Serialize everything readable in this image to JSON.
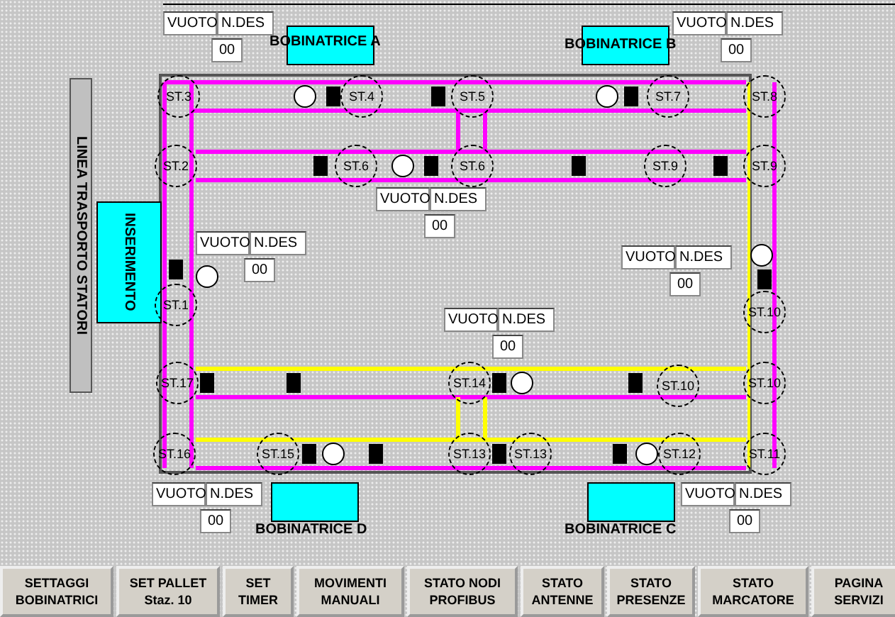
{
  "line_label": "LINEA TRASPORTO STATORI",
  "insertion_label": "INSERIMENTO",
  "winders": [
    {
      "label": "BOBINATRICE A"
    },
    {
      "label": "BOBINATRICE B"
    },
    {
      "label": "BOBINATRICE D"
    },
    {
      "label": "BOBINATRICE C"
    }
  ],
  "counters": [
    {
      "empty": "VUOTO",
      "count_label": "N.DES",
      "value": "00"
    },
    {
      "empty": "VUOTO",
      "count_label": "N.DES",
      "value": "00"
    },
    {
      "empty": "VUOTO",
      "count_label": "N.DES",
      "value": "00"
    },
    {
      "empty": "VUOTO",
      "count_label": "N.DES",
      "value": "00"
    },
    {
      "empty": "VUOTO",
      "count_label": "N.DES",
      "value": "00"
    },
    {
      "empty": "VUOTO",
      "count_label": "N.DES",
      "value": "00"
    },
    {
      "empty": "VUOTO",
      "count_label": "N.DES",
      "value": "00"
    },
    {
      "empty": "VUOTO",
      "count_label": "N.DES",
      "value": "00"
    }
  ],
  "stations": [
    "ST.3",
    "ST.4",
    "ST.5",
    "ST.7",
    "ST.8",
    "ST.2",
    "ST.6",
    "ST.6",
    "ST.9",
    "ST.9",
    "ST.1",
    "ST.10",
    "ST.17",
    "ST.14",
    "ST.10",
    "ST.10",
    "ST.16",
    "ST.15",
    "ST.13",
    "ST.13",
    "ST.12",
    "ST.11"
  ],
  "buttons": [
    {
      "lines": [
        "SETTAGGI",
        "BOBINATRICI"
      ]
    },
    {
      "lines": [
        "SET PALLET",
        "Staz. 10"
      ]
    },
    {
      "lines": [
        "SET",
        "TIMER"
      ]
    },
    {
      "lines": [
        "MOVIMENTI",
        "MANUALI"
      ]
    },
    {
      "lines": [
        "STATO NODI",
        "PROFIBUS"
      ]
    },
    {
      "lines": [
        "STATO",
        "ANTENNE"
      ]
    },
    {
      "lines": [
        "STATO",
        "PRESENZE"
      ]
    },
    {
      "lines": [
        "STATO",
        "MARCATORE"
      ]
    },
    {
      "lines": [
        "PAGINA",
        "SERVIZI"
      ]
    }
  ]
}
